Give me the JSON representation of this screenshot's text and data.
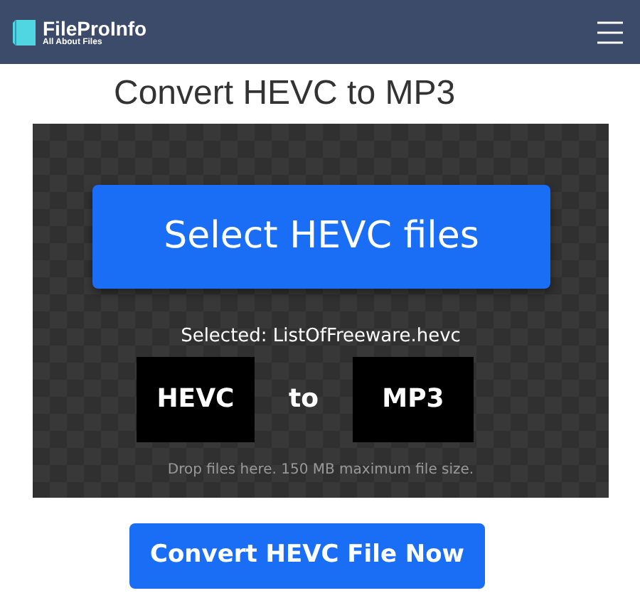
{
  "navbar": {
    "brand": "FileProInfo",
    "tagline": "All About Files"
  },
  "title": "Convert HEVC to MP3",
  "dropzone": {
    "select_button": "Select HEVC files",
    "selected": "Selected: ListOfFreeware.hevc",
    "from_format": "HEVC",
    "separator": "to",
    "to_format": "MP3",
    "hint": "Drop files here. 150 MB maximum file size."
  },
  "convert_button": "Convert HEVC File Now"
}
